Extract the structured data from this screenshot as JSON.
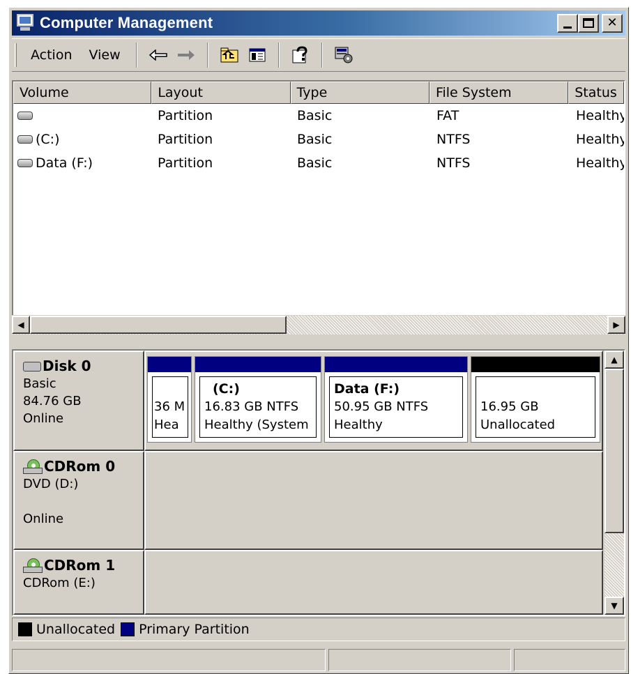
{
  "window": {
    "title": "Computer Management"
  },
  "menu": {
    "action": "Action",
    "view": "View"
  },
  "toolbar_icons": [
    "back-arrow-icon",
    "forward-arrow-icon",
    "up-folder-icon",
    "show-hide-tree-icon",
    "help-icon",
    "properties-icon"
  ],
  "volume_list": {
    "columns": [
      "Volume",
      "Layout",
      "Type",
      "File System",
      "Status"
    ],
    "rows": [
      {
        "volume": "",
        "layout": "Partition",
        "type": "Basic",
        "file_system": "FAT",
        "status": "Healthy"
      },
      {
        "volume": "(C:)",
        "layout": "Partition",
        "type": "Basic",
        "file_system": "NTFS",
        "status": "Healthy"
      },
      {
        "volume": "Data (F:)",
        "layout": "Partition",
        "type": "Basic",
        "file_system": "NTFS",
        "status": "Healthy"
      }
    ]
  },
  "disks": [
    {
      "name": "Disk 0",
      "kind": "Basic",
      "size": "84.76 GB",
      "state": "Online",
      "partitions": [
        {
          "name": "",
          "size": "36 M",
          "status": "Hea",
          "color": "#000080"
        },
        {
          "name": "(C:)",
          "size": "16.83 GB NTFS",
          "status": "Healthy (System",
          "color": "#000080"
        },
        {
          "name": "Data  (F:)",
          "size": "50.95 GB NTFS",
          "status": "Healthy",
          "color": "#000080"
        },
        {
          "name": "",
          "size": "16.95 GB",
          "status": "Unallocated",
          "color": "#000000"
        }
      ]
    },
    {
      "name": "CDRom 0",
      "line2": "DVD (D:)",
      "state": "Online"
    },
    {
      "name": "CDRom 1",
      "line2": "CDRom (E:)"
    }
  ],
  "legend": [
    {
      "label": "Unallocated",
      "color": "#000000"
    },
    {
      "label": "Primary Partition",
      "color": "#000080"
    }
  ],
  "colors": {
    "titlebar_start": "#0a246a",
    "titlebar_end": "#a6caf0",
    "face": "#d4d0c8"
  }
}
